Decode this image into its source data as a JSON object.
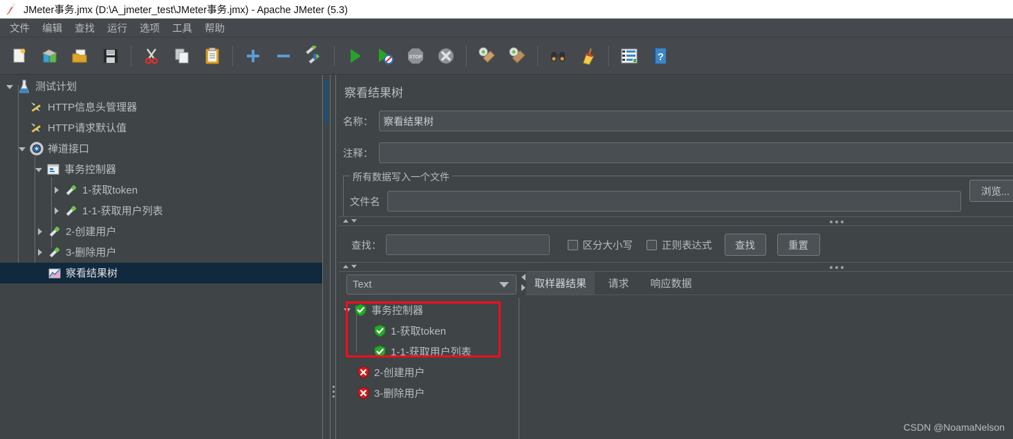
{
  "window": {
    "title": "JMeter事务.jmx (D:\\A_jmeter_test\\JMeter事务.jmx) - Apache JMeter (5.3)",
    "icon": "jmeter-feather-icon"
  },
  "menubar": {
    "items": [
      {
        "label": "文件",
        "name": "menu-file"
      },
      {
        "label": "编辑",
        "name": "menu-edit"
      },
      {
        "label": "查找",
        "name": "menu-search"
      },
      {
        "label": "运行",
        "name": "menu-run"
      },
      {
        "label": "选项",
        "name": "menu-options"
      },
      {
        "label": "工具",
        "name": "menu-tools"
      },
      {
        "label": "帮助",
        "name": "menu-help"
      }
    ]
  },
  "toolbar": {
    "buttons": [
      {
        "icon": "new-document-icon",
        "name": "toolbar-new"
      },
      {
        "icon": "templates-icon",
        "name": "toolbar-templates"
      },
      {
        "icon": "open-folder-icon",
        "name": "toolbar-open"
      },
      {
        "icon": "save-floppy-icon",
        "name": "toolbar-save"
      },
      {
        "icon": "cut-scissors-icon",
        "name": "toolbar-cut"
      },
      {
        "icon": "copy-pages-icon",
        "name": "toolbar-copy"
      },
      {
        "icon": "paste-clipboard-icon",
        "name": "toolbar-paste"
      },
      {
        "icon": "plus-icon",
        "name": "toolbar-expand-all"
      },
      {
        "icon": "minus-icon",
        "name": "toolbar-collapse-all"
      },
      {
        "icon": "toggle-element-icon",
        "name": "toolbar-toggle"
      },
      {
        "icon": "start-play-icon",
        "name": "toolbar-start"
      },
      {
        "icon": "start-no-timers-icon",
        "name": "toolbar-start-no-pauses"
      },
      {
        "icon": "stop-icon",
        "name": "toolbar-stop"
      },
      {
        "icon": "shutdown-icon",
        "name": "toolbar-shutdown"
      },
      {
        "icon": "clear-icon",
        "name": "toolbar-clear"
      },
      {
        "icon": "clear-all-icon",
        "name": "toolbar-clear-all"
      },
      {
        "icon": "binoculars-search-icon",
        "name": "toolbar-search"
      },
      {
        "icon": "reset-search-broom-icon",
        "name": "toolbar-reset-search"
      },
      {
        "icon": "function-helper-icon",
        "name": "toolbar-function-helper"
      },
      {
        "icon": "help-book-icon",
        "name": "toolbar-help"
      }
    ]
  },
  "tree": {
    "nodes": [
      {
        "label": "测试计划",
        "icon": "test-plan-icon",
        "depth": 0,
        "toggle": "down",
        "selected": false,
        "name": "tree-node-test-plan"
      },
      {
        "label": "HTTP信息头管理器",
        "icon": "header-manager-icon",
        "depth": 1,
        "toggle": "none",
        "selected": false,
        "name": "tree-node-http-header-manager"
      },
      {
        "label": "HTTP请求默认值",
        "icon": "http-defaults-icon",
        "depth": 1,
        "toggle": "none",
        "selected": false,
        "name": "tree-node-http-request-defaults"
      },
      {
        "label": "禅道接口",
        "icon": "thread-group-icon",
        "depth": 1,
        "toggle": "down",
        "selected": false,
        "name": "tree-node-thread-group"
      },
      {
        "label": "事务控制器",
        "icon": "transaction-controller-icon",
        "depth": 2,
        "toggle": "down",
        "selected": false,
        "name": "tree-node-transaction-controller"
      },
      {
        "label": "1-获取token",
        "icon": "http-sampler-icon",
        "depth": 3,
        "toggle": "right",
        "selected": false,
        "name": "tree-node-sampler-1"
      },
      {
        "label": "1-1-获取用户列表",
        "icon": "http-sampler-icon",
        "depth": 3,
        "toggle": "right",
        "selected": false,
        "name": "tree-node-sampler-1-1"
      },
      {
        "label": "2-创建用户",
        "icon": "http-sampler-icon",
        "depth": 2,
        "toggle": "right",
        "selected": false,
        "name": "tree-node-sampler-2"
      },
      {
        "label": "3-删除用户",
        "icon": "http-sampler-icon",
        "depth": 2,
        "toggle": "right",
        "selected": false,
        "name": "tree-node-sampler-3"
      },
      {
        "label": "察看结果树",
        "icon": "view-results-tree-icon",
        "depth": 2,
        "toggle": "none",
        "selected": true,
        "name": "tree-node-view-results-tree"
      }
    ]
  },
  "panel": {
    "title": "察看结果树",
    "name_label": "名称：",
    "name_value": "察看结果树",
    "comment_label": "注释：",
    "comment_value": "",
    "fieldset_legend": "所有数据写入一个文件",
    "filename_label": "文件名",
    "filename_value": "",
    "browse_button": "浏览...",
    "search_label": "查找：",
    "search_value": "",
    "case_sensitive_label": "区分大小写",
    "regex_label": "正则表达式",
    "search_button": "查找",
    "reset_button": "重置",
    "renderer_value": "Text"
  },
  "results": {
    "nodes": [
      {
        "label": "事务控制器",
        "status": "success",
        "depth": 0,
        "toggle": "down",
        "name": "result-node-transaction-controller"
      },
      {
        "label": "1-获取token",
        "status": "success",
        "depth": 1,
        "toggle": "none",
        "name": "result-node-1"
      },
      {
        "label": "1-1-获取用户列表",
        "status": "success",
        "depth": 1,
        "toggle": "none",
        "name": "result-node-1-1"
      },
      {
        "label": "2-创建用户",
        "status": "error",
        "depth": 0,
        "toggle": "none",
        "name": "result-node-2"
      },
      {
        "label": "3-删除用户",
        "status": "error",
        "depth": 0,
        "toggle": "none",
        "name": "result-node-3"
      }
    ],
    "highlight_color": "#fc0d1c"
  },
  "tabs": [
    {
      "label": "取样器结果",
      "active": true,
      "name": "tab-sampler-result"
    },
    {
      "label": "请求",
      "active": false,
      "name": "tab-request"
    },
    {
      "label": "响应数据",
      "active": false,
      "name": "tab-response-data"
    }
  ],
  "watermark": "CSDN @NoamaNelson",
  "colors": {
    "window_bg": "#3f4447",
    "toolbar_bg": "#45494d",
    "selection": "#10293c",
    "success": "#2aa92a",
    "error": "#cc1f1f",
    "accent_blue": "#3a85c8"
  }
}
